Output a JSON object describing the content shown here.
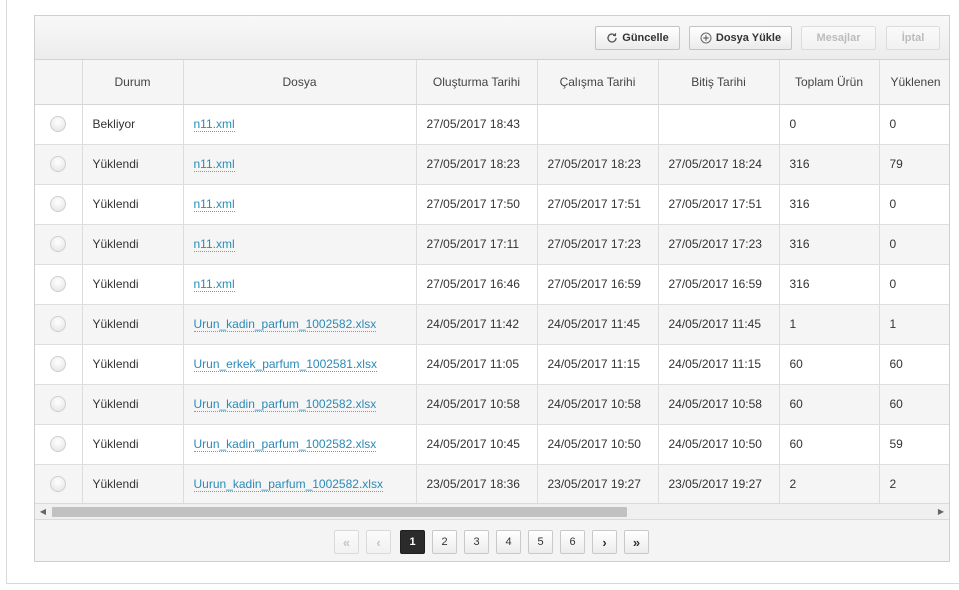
{
  "toolbar": {
    "refresh_label": "Güncelle",
    "upload_label": "Dosya Yükle",
    "messages_label": "Mesajlar",
    "cancel_label": "İptal"
  },
  "table": {
    "columns": [
      "",
      "Durum",
      "Dosya",
      "Oluşturma Tarihi",
      "Çalışma Tarihi",
      "Bitiş Tarihi",
      "Toplam Ürün",
      "Yüklenen"
    ],
    "rows": [
      {
        "status": "Bekliyor",
        "file": "n11.xml",
        "created": "27/05/2017 18:43",
        "started": "",
        "finished": "",
        "total": "0",
        "uploaded": "0"
      },
      {
        "status": "Yüklendi",
        "file": "n11.xml",
        "created": "27/05/2017 18:23",
        "started": "27/05/2017 18:23",
        "finished": "27/05/2017 18:24",
        "total": "316",
        "uploaded": "79"
      },
      {
        "status": "Yüklendi",
        "file": "n11.xml",
        "created": "27/05/2017 17:50",
        "started": "27/05/2017 17:51",
        "finished": "27/05/2017 17:51",
        "total": "316",
        "uploaded": "0"
      },
      {
        "status": "Yüklendi",
        "file": "n11.xml",
        "created": "27/05/2017 17:11",
        "started": "27/05/2017 17:23",
        "finished": "27/05/2017 17:23",
        "total": "316",
        "uploaded": "0"
      },
      {
        "status": "Yüklendi",
        "file": "n11.xml",
        "created": "27/05/2017 16:46",
        "started": "27/05/2017 16:59",
        "finished": "27/05/2017 16:59",
        "total": "316",
        "uploaded": "0"
      },
      {
        "status": "Yüklendi",
        "file": "Urun_kadin_parfum_1002582.xlsx",
        "created": "24/05/2017 11:42",
        "started": "24/05/2017 11:45",
        "finished": "24/05/2017 11:45",
        "total": "1",
        "uploaded": "1"
      },
      {
        "status": "Yüklendi",
        "file": "Urun_erkek_parfum_1002581.xlsx",
        "created": "24/05/2017 11:05",
        "started": "24/05/2017 11:15",
        "finished": "24/05/2017 11:15",
        "total": "60",
        "uploaded": "60"
      },
      {
        "status": "Yüklendi",
        "file": "Urun_kadin_parfum_1002582.xlsx",
        "created": "24/05/2017 10:58",
        "started": "24/05/2017 10:58",
        "finished": "24/05/2017 10:58",
        "total": "60",
        "uploaded": "60"
      },
      {
        "status": "Yüklendi",
        "file": "Urun_kadin_parfum_1002582.xlsx",
        "created": "24/05/2017 10:45",
        "started": "24/05/2017 10:50",
        "finished": "24/05/2017 10:50",
        "total": "60",
        "uploaded": "59"
      },
      {
        "status": "Yüklendi",
        "file": "Uurun_kadin_parfum_1002582.xlsx",
        "created": "23/05/2017 18:36",
        "started": "23/05/2017 19:27",
        "finished": "23/05/2017 19:27",
        "total": "2",
        "uploaded": "2"
      }
    ]
  },
  "pagination": {
    "first_label": "«",
    "prev_label": "‹",
    "pages": [
      "1",
      "2",
      "3",
      "4",
      "5",
      "6"
    ],
    "current_page": "1",
    "next_label": "›",
    "last_label": "»"
  },
  "icons": {
    "refresh": "refresh-icon",
    "upload": "plus-circle-icon"
  }
}
